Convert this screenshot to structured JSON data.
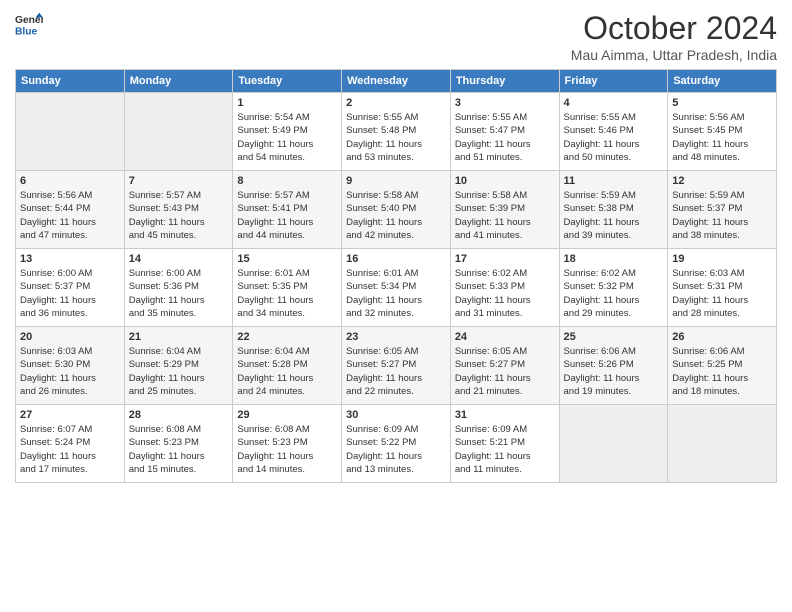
{
  "header": {
    "logo_line1": "General",
    "logo_line2": "Blue",
    "month": "October 2024",
    "location": "Mau Aimma, Uttar Pradesh, India"
  },
  "weekdays": [
    "Sunday",
    "Monday",
    "Tuesday",
    "Wednesday",
    "Thursday",
    "Friday",
    "Saturday"
  ],
  "weeks": [
    [
      {
        "day": "",
        "info": ""
      },
      {
        "day": "",
        "info": ""
      },
      {
        "day": "1",
        "info": "Sunrise: 5:54 AM\nSunset: 5:49 PM\nDaylight: 11 hours\nand 54 minutes."
      },
      {
        "day": "2",
        "info": "Sunrise: 5:55 AM\nSunset: 5:48 PM\nDaylight: 11 hours\nand 53 minutes."
      },
      {
        "day": "3",
        "info": "Sunrise: 5:55 AM\nSunset: 5:47 PM\nDaylight: 11 hours\nand 51 minutes."
      },
      {
        "day": "4",
        "info": "Sunrise: 5:55 AM\nSunset: 5:46 PM\nDaylight: 11 hours\nand 50 minutes."
      },
      {
        "day": "5",
        "info": "Sunrise: 5:56 AM\nSunset: 5:45 PM\nDaylight: 11 hours\nand 48 minutes."
      }
    ],
    [
      {
        "day": "6",
        "info": "Sunrise: 5:56 AM\nSunset: 5:44 PM\nDaylight: 11 hours\nand 47 minutes."
      },
      {
        "day": "7",
        "info": "Sunrise: 5:57 AM\nSunset: 5:43 PM\nDaylight: 11 hours\nand 45 minutes."
      },
      {
        "day": "8",
        "info": "Sunrise: 5:57 AM\nSunset: 5:41 PM\nDaylight: 11 hours\nand 44 minutes."
      },
      {
        "day": "9",
        "info": "Sunrise: 5:58 AM\nSunset: 5:40 PM\nDaylight: 11 hours\nand 42 minutes."
      },
      {
        "day": "10",
        "info": "Sunrise: 5:58 AM\nSunset: 5:39 PM\nDaylight: 11 hours\nand 41 minutes."
      },
      {
        "day": "11",
        "info": "Sunrise: 5:59 AM\nSunset: 5:38 PM\nDaylight: 11 hours\nand 39 minutes."
      },
      {
        "day": "12",
        "info": "Sunrise: 5:59 AM\nSunset: 5:37 PM\nDaylight: 11 hours\nand 38 minutes."
      }
    ],
    [
      {
        "day": "13",
        "info": "Sunrise: 6:00 AM\nSunset: 5:37 PM\nDaylight: 11 hours\nand 36 minutes."
      },
      {
        "day": "14",
        "info": "Sunrise: 6:00 AM\nSunset: 5:36 PM\nDaylight: 11 hours\nand 35 minutes."
      },
      {
        "day": "15",
        "info": "Sunrise: 6:01 AM\nSunset: 5:35 PM\nDaylight: 11 hours\nand 34 minutes."
      },
      {
        "day": "16",
        "info": "Sunrise: 6:01 AM\nSunset: 5:34 PM\nDaylight: 11 hours\nand 32 minutes."
      },
      {
        "day": "17",
        "info": "Sunrise: 6:02 AM\nSunset: 5:33 PM\nDaylight: 11 hours\nand 31 minutes."
      },
      {
        "day": "18",
        "info": "Sunrise: 6:02 AM\nSunset: 5:32 PM\nDaylight: 11 hours\nand 29 minutes."
      },
      {
        "day": "19",
        "info": "Sunrise: 6:03 AM\nSunset: 5:31 PM\nDaylight: 11 hours\nand 28 minutes."
      }
    ],
    [
      {
        "day": "20",
        "info": "Sunrise: 6:03 AM\nSunset: 5:30 PM\nDaylight: 11 hours\nand 26 minutes."
      },
      {
        "day": "21",
        "info": "Sunrise: 6:04 AM\nSunset: 5:29 PM\nDaylight: 11 hours\nand 25 minutes."
      },
      {
        "day": "22",
        "info": "Sunrise: 6:04 AM\nSunset: 5:28 PM\nDaylight: 11 hours\nand 24 minutes."
      },
      {
        "day": "23",
        "info": "Sunrise: 6:05 AM\nSunset: 5:27 PM\nDaylight: 11 hours\nand 22 minutes."
      },
      {
        "day": "24",
        "info": "Sunrise: 6:05 AM\nSunset: 5:27 PM\nDaylight: 11 hours\nand 21 minutes."
      },
      {
        "day": "25",
        "info": "Sunrise: 6:06 AM\nSunset: 5:26 PM\nDaylight: 11 hours\nand 19 minutes."
      },
      {
        "day": "26",
        "info": "Sunrise: 6:06 AM\nSunset: 5:25 PM\nDaylight: 11 hours\nand 18 minutes."
      }
    ],
    [
      {
        "day": "27",
        "info": "Sunrise: 6:07 AM\nSunset: 5:24 PM\nDaylight: 11 hours\nand 17 minutes."
      },
      {
        "day": "28",
        "info": "Sunrise: 6:08 AM\nSunset: 5:23 PM\nDaylight: 11 hours\nand 15 minutes."
      },
      {
        "day": "29",
        "info": "Sunrise: 6:08 AM\nSunset: 5:23 PM\nDaylight: 11 hours\nand 14 minutes."
      },
      {
        "day": "30",
        "info": "Sunrise: 6:09 AM\nSunset: 5:22 PM\nDaylight: 11 hours\nand 13 minutes."
      },
      {
        "day": "31",
        "info": "Sunrise: 6:09 AM\nSunset: 5:21 PM\nDaylight: 11 hours\nand 11 minutes."
      },
      {
        "day": "",
        "info": ""
      },
      {
        "day": "",
        "info": ""
      }
    ]
  ]
}
